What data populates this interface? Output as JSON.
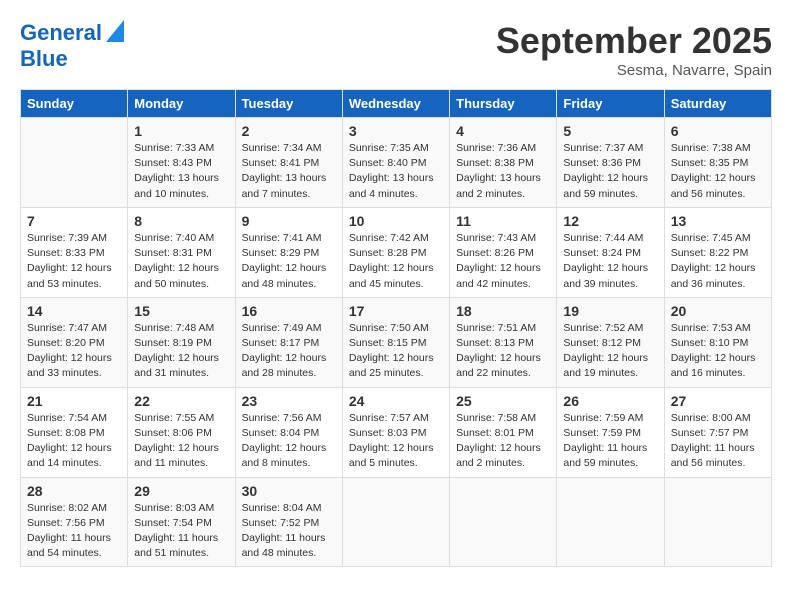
{
  "header": {
    "logo_line1": "General",
    "logo_line2": "Blue",
    "month": "September 2025",
    "location": "Sesma, Navarre, Spain"
  },
  "days_of_week": [
    "Sunday",
    "Monday",
    "Tuesday",
    "Wednesday",
    "Thursday",
    "Friday",
    "Saturday"
  ],
  "weeks": [
    [
      {
        "num": "",
        "text": ""
      },
      {
        "num": "1",
        "text": "Sunrise: 7:33 AM\nSunset: 8:43 PM\nDaylight: 13 hours\nand 10 minutes."
      },
      {
        "num": "2",
        "text": "Sunrise: 7:34 AM\nSunset: 8:41 PM\nDaylight: 13 hours\nand 7 minutes."
      },
      {
        "num": "3",
        "text": "Sunrise: 7:35 AM\nSunset: 8:40 PM\nDaylight: 13 hours\nand 4 minutes."
      },
      {
        "num": "4",
        "text": "Sunrise: 7:36 AM\nSunset: 8:38 PM\nDaylight: 13 hours\nand 2 minutes."
      },
      {
        "num": "5",
        "text": "Sunrise: 7:37 AM\nSunset: 8:36 PM\nDaylight: 12 hours\nand 59 minutes."
      },
      {
        "num": "6",
        "text": "Sunrise: 7:38 AM\nSunset: 8:35 PM\nDaylight: 12 hours\nand 56 minutes."
      }
    ],
    [
      {
        "num": "7",
        "text": "Sunrise: 7:39 AM\nSunset: 8:33 PM\nDaylight: 12 hours\nand 53 minutes."
      },
      {
        "num": "8",
        "text": "Sunrise: 7:40 AM\nSunset: 8:31 PM\nDaylight: 12 hours\nand 50 minutes."
      },
      {
        "num": "9",
        "text": "Sunrise: 7:41 AM\nSunset: 8:29 PM\nDaylight: 12 hours\nand 48 minutes."
      },
      {
        "num": "10",
        "text": "Sunrise: 7:42 AM\nSunset: 8:28 PM\nDaylight: 12 hours\nand 45 minutes."
      },
      {
        "num": "11",
        "text": "Sunrise: 7:43 AM\nSunset: 8:26 PM\nDaylight: 12 hours\nand 42 minutes."
      },
      {
        "num": "12",
        "text": "Sunrise: 7:44 AM\nSunset: 8:24 PM\nDaylight: 12 hours\nand 39 minutes."
      },
      {
        "num": "13",
        "text": "Sunrise: 7:45 AM\nSunset: 8:22 PM\nDaylight: 12 hours\nand 36 minutes."
      }
    ],
    [
      {
        "num": "14",
        "text": "Sunrise: 7:47 AM\nSunset: 8:20 PM\nDaylight: 12 hours\nand 33 minutes."
      },
      {
        "num": "15",
        "text": "Sunrise: 7:48 AM\nSunset: 8:19 PM\nDaylight: 12 hours\nand 31 minutes."
      },
      {
        "num": "16",
        "text": "Sunrise: 7:49 AM\nSunset: 8:17 PM\nDaylight: 12 hours\nand 28 minutes."
      },
      {
        "num": "17",
        "text": "Sunrise: 7:50 AM\nSunset: 8:15 PM\nDaylight: 12 hours\nand 25 minutes."
      },
      {
        "num": "18",
        "text": "Sunrise: 7:51 AM\nSunset: 8:13 PM\nDaylight: 12 hours\nand 22 minutes."
      },
      {
        "num": "19",
        "text": "Sunrise: 7:52 AM\nSunset: 8:12 PM\nDaylight: 12 hours\nand 19 minutes."
      },
      {
        "num": "20",
        "text": "Sunrise: 7:53 AM\nSunset: 8:10 PM\nDaylight: 12 hours\nand 16 minutes."
      }
    ],
    [
      {
        "num": "21",
        "text": "Sunrise: 7:54 AM\nSunset: 8:08 PM\nDaylight: 12 hours\nand 14 minutes."
      },
      {
        "num": "22",
        "text": "Sunrise: 7:55 AM\nSunset: 8:06 PM\nDaylight: 12 hours\nand 11 minutes."
      },
      {
        "num": "23",
        "text": "Sunrise: 7:56 AM\nSunset: 8:04 PM\nDaylight: 12 hours\nand 8 minutes."
      },
      {
        "num": "24",
        "text": "Sunrise: 7:57 AM\nSunset: 8:03 PM\nDaylight: 12 hours\nand 5 minutes."
      },
      {
        "num": "25",
        "text": "Sunrise: 7:58 AM\nSunset: 8:01 PM\nDaylight: 12 hours\nand 2 minutes."
      },
      {
        "num": "26",
        "text": "Sunrise: 7:59 AM\nSunset: 7:59 PM\nDaylight: 11 hours\nand 59 minutes."
      },
      {
        "num": "27",
        "text": "Sunrise: 8:00 AM\nSunset: 7:57 PM\nDaylight: 11 hours\nand 56 minutes."
      }
    ],
    [
      {
        "num": "28",
        "text": "Sunrise: 8:02 AM\nSunset: 7:56 PM\nDaylight: 11 hours\nand 54 minutes."
      },
      {
        "num": "29",
        "text": "Sunrise: 8:03 AM\nSunset: 7:54 PM\nDaylight: 11 hours\nand 51 minutes."
      },
      {
        "num": "30",
        "text": "Sunrise: 8:04 AM\nSunset: 7:52 PM\nDaylight: 11 hours\nand 48 minutes."
      },
      {
        "num": "",
        "text": ""
      },
      {
        "num": "",
        "text": ""
      },
      {
        "num": "",
        "text": ""
      },
      {
        "num": "",
        "text": ""
      }
    ]
  ]
}
